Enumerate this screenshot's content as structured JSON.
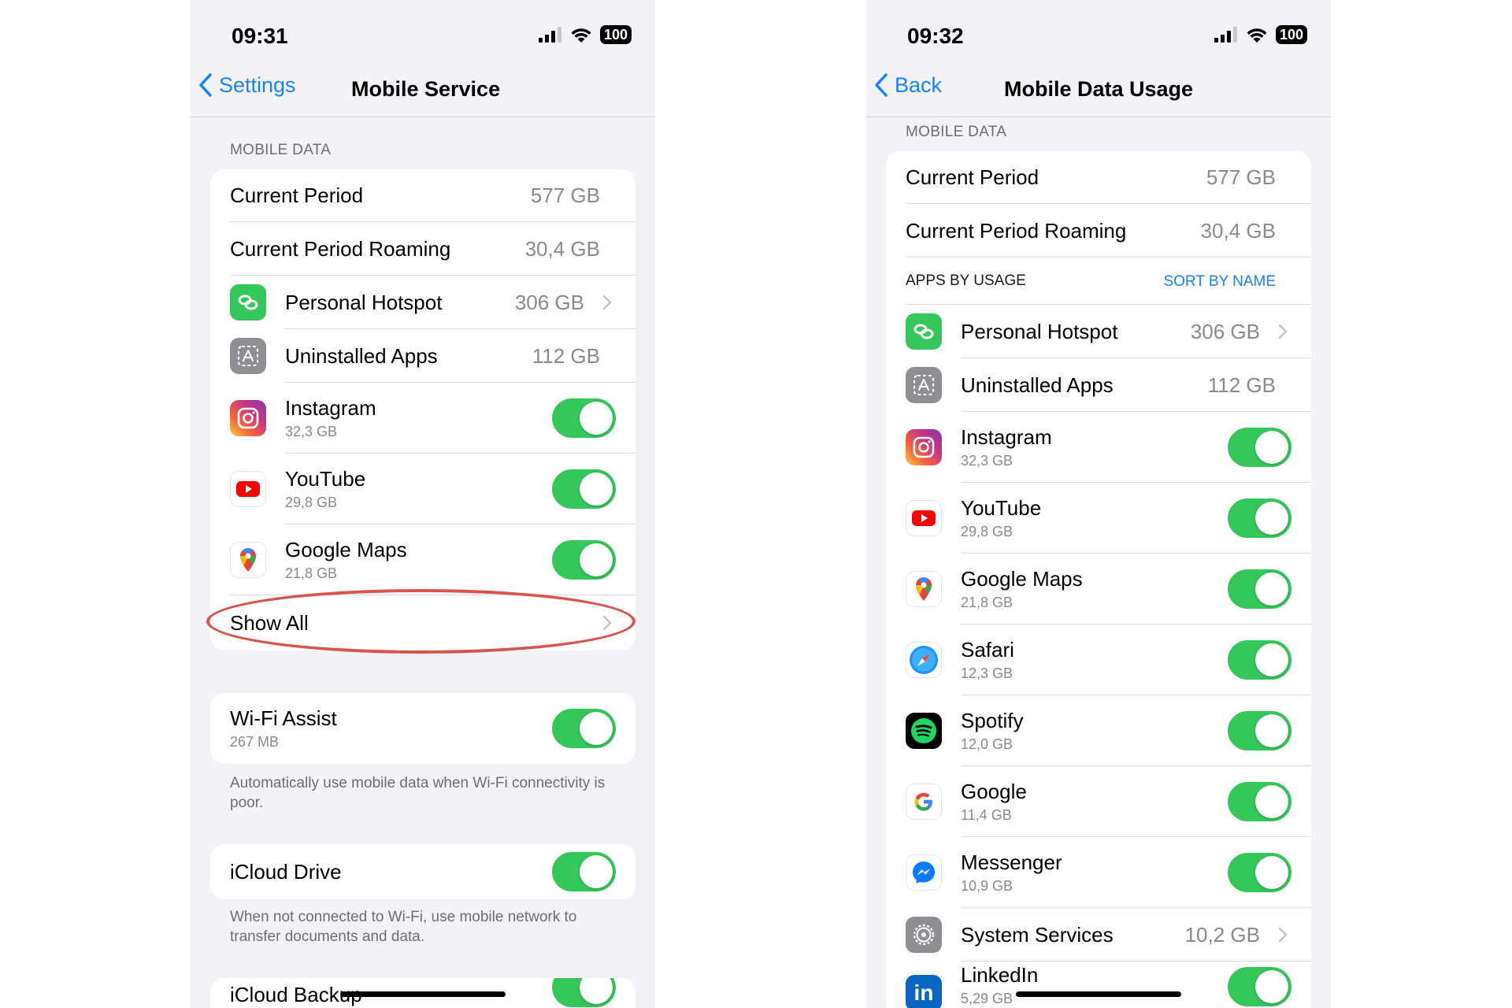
{
  "colors": {
    "accent": "#1a82fb",
    "toggle_on": "#34c759",
    "annotation": "#d9534f"
  },
  "left": {
    "status": {
      "time": "09:31",
      "battery": "100"
    },
    "nav": {
      "back_label": "Settings",
      "title": "Mobile Service"
    },
    "section_header": "MOBILE DATA",
    "current_period": {
      "label": "Current Period",
      "value": "577 GB"
    },
    "roaming": {
      "label": "Current Period Roaming",
      "value": "30,4 GB"
    },
    "hotspot": {
      "label": "Personal Hotspot",
      "value": "306 GB",
      "icon": "hotspot-icon"
    },
    "uninstalled": {
      "label": "Uninstalled Apps",
      "value": "112 GB",
      "icon": "app-store-icon"
    },
    "apps": [
      {
        "name": "Instagram",
        "usage": "32,3 GB",
        "icon": "instagram-icon",
        "enabled": true
      },
      {
        "name": "YouTube",
        "usage": "29,8 GB",
        "icon": "youtube-icon",
        "enabled": true
      },
      {
        "name": "Google Maps",
        "usage": "21,8 GB",
        "icon": "google-maps-icon",
        "enabled": true
      }
    ],
    "show_all": "Show All",
    "wifi_assist": {
      "label": "Wi-Fi Assist",
      "usage": "267 MB",
      "enabled": true,
      "footnote": "Automatically use mobile data when Wi-Fi connectivity is poor."
    },
    "icloud_drive": {
      "label": "iCloud Drive",
      "enabled": true,
      "footnote": "When not connected to Wi-Fi, use mobile network to transfer documents and data."
    },
    "icloud_backup": {
      "label": "iCloud Backup",
      "enabled": true
    }
  },
  "right": {
    "status": {
      "time": "09:32",
      "battery": "100"
    },
    "nav": {
      "back_label": "Back",
      "title": "Mobile Data Usage"
    },
    "section_header": "MOBILE DATA",
    "current_period": {
      "label": "Current Period",
      "value": "577 GB"
    },
    "roaming": {
      "label": "Current Period Roaming",
      "value": "30,4 GB"
    },
    "apps_header": "APPS BY USAGE",
    "sort_label": "SORT BY NAME",
    "hotspot": {
      "label": "Personal Hotspot",
      "value": "306 GB",
      "icon": "hotspot-icon"
    },
    "uninstalled": {
      "label": "Uninstalled Apps",
      "value": "112 GB",
      "icon": "app-store-icon"
    },
    "apps": [
      {
        "name": "Instagram",
        "usage": "32,3 GB",
        "icon": "instagram-icon",
        "enabled": true
      },
      {
        "name": "YouTube",
        "usage": "29,8 GB",
        "icon": "youtube-icon",
        "enabled": true
      },
      {
        "name": "Google Maps",
        "usage": "21,8 GB",
        "icon": "google-maps-icon",
        "enabled": true
      },
      {
        "name": "Safari",
        "usage": "12,3 GB",
        "icon": "safari-icon",
        "enabled": true
      },
      {
        "name": "Spotify",
        "usage": "12,0 GB",
        "icon": "spotify-icon",
        "enabled": true
      },
      {
        "name": "Google",
        "usage": "11,4 GB",
        "icon": "google-icon",
        "enabled": true
      },
      {
        "name": "Messenger",
        "usage": "10,9 GB",
        "icon": "messenger-icon",
        "enabled": true
      }
    ],
    "system_services": {
      "label": "System Services",
      "value": "10,2 GB",
      "icon": "gear-icon"
    },
    "linkedin": {
      "name": "LinkedIn",
      "usage": "5,29 GB",
      "icon": "linkedin-icon",
      "enabled": true
    }
  }
}
